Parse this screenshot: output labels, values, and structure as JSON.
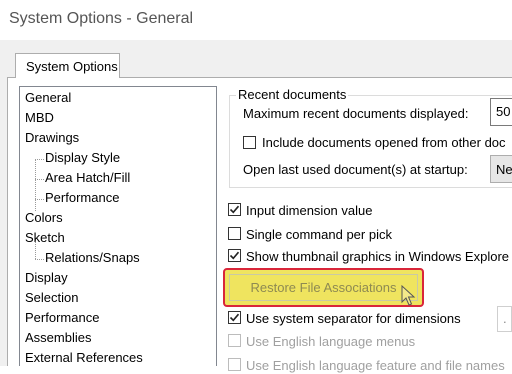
{
  "window": {
    "title": "System Options - General"
  },
  "tabs": [
    {
      "label": "System Options"
    }
  ],
  "tree": {
    "items": [
      {
        "label": "General",
        "indent": 0
      },
      {
        "label": "MBD",
        "indent": 0
      },
      {
        "label": "Drawings",
        "indent": 0
      },
      {
        "label": "Display Style",
        "indent": 1
      },
      {
        "label": "Area Hatch/Fill",
        "indent": 1
      },
      {
        "label": "Performance",
        "indent": 1
      },
      {
        "label": "Colors",
        "indent": 0
      },
      {
        "label": "Sketch",
        "indent": 0
      },
      {
        "label": "Relations/Snaps",
        "indent": 1
      },
      {
        "label": "Display",
        "indent": 0
      },
      {
        "label": "Selection",
        "indent": 0
      },
      {
        "label": "Performance",
        "indent": 0
      },
      {
        "label": "Assemblies",
        "indent": 0
      },
      {
        "label": "External References",
        "indent": 0
      }
    ]
  },
  "recent_documents": {
    "legend": "Recent documents",
    "max_label": "Maximum recent documents displayed:",
    "max_value": "50",
    "include_label": "Include documents opened from other doc",
    "include_checked": false,
    "open_last_label": "Open last used document(s) at startup:",
    "open_last_value": "Ne"
  },
  "options": [
    {
      "label": "Input dimension value",
      "checked": true,
      "disabled": false
    },
    {
      "label": "Single command per pick",
      "checked": false,
      "disabled": false
    },
    {
      "label": "Show thumbnail graphics in Windows Explore",
      "checked": true,
      "disabled": false
    }
  ],
  "restore_button": {
    "label": "Restore File Associations"
  },
  "options_lower": [
    {
      "label": "Use system separator for dimensions",
      "checked": true,
      "disabled": false
    },
    {
      "label": "Use English language menus",
      "checked": false,
      "disabled": true
    },
    {
      "label": "Use English language feature and file names",
      "checked": false,
      "disabled": true
    }
  ],
  "separator_field": {
    "value": "."
  }
}
